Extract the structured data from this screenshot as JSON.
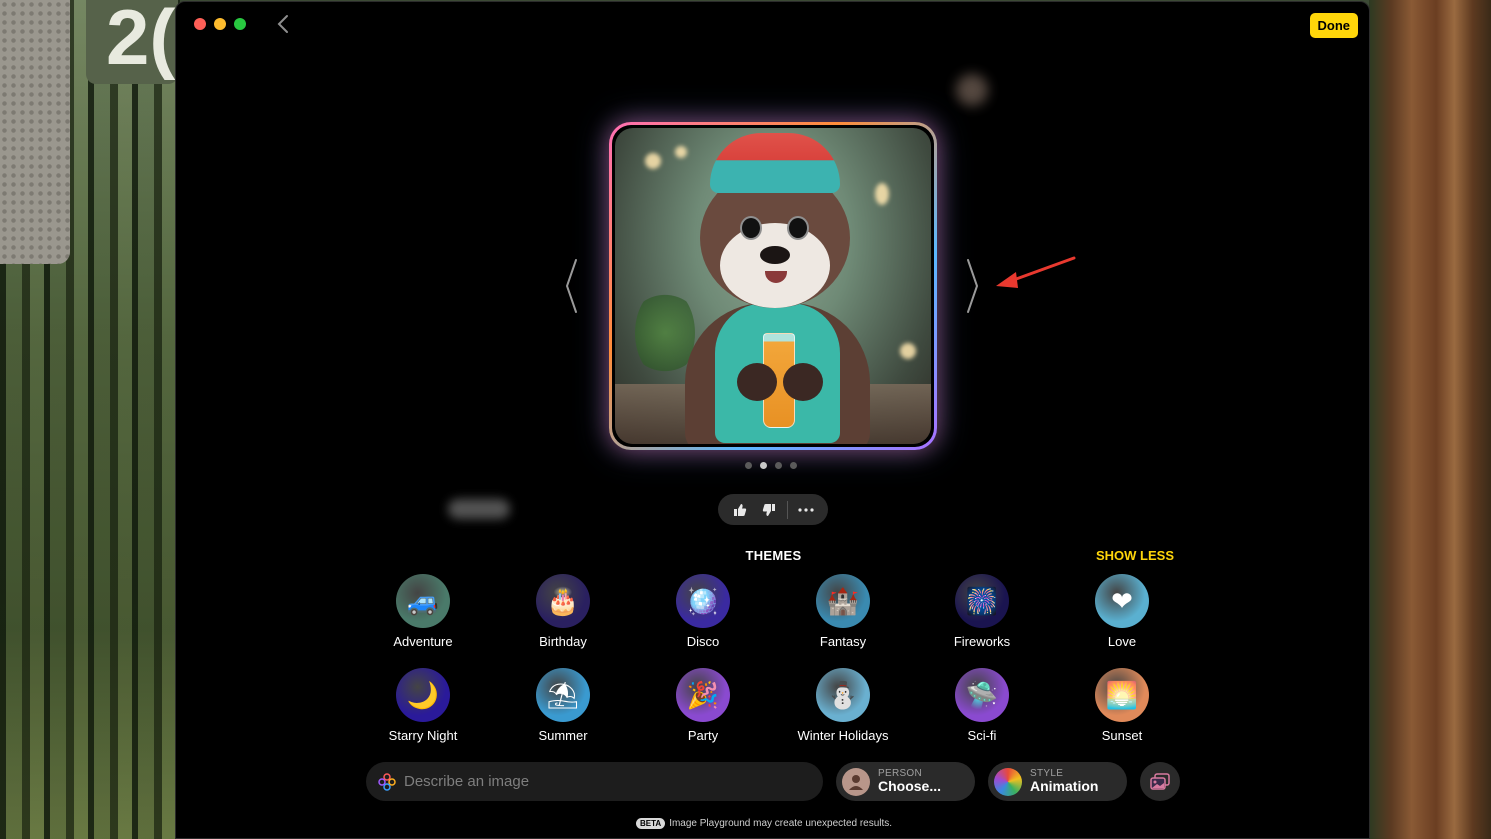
{
  "window": {
    "done_label": "Done",
    "back_icon": "chevron-left-icon"
  },
  "desktop": {
    "widget_text": "2("
  },
  "preview": {
    "subject": "otter holding a drink wearing a beanie",
    "page_count": 4,
    "active_page": 2
  },
  "themes": {
    "title": "THEMES",
    "toggle_label": "SHOW LESS",
    "items": [
      {
        "label": "Adventure",
        "icon": "jeep-icon",
        "color": "#4a7a6a",
        "glyph": "🚙"
      },
      {
        "label": "Birthday",
        "icon": "cake-icon",
        "color": "#2a2060",
        "glyph": "🎂"
      },
      {
        "label": "Disco",
        "icon": "disco-ball-icon",
        "color": "#3a2aa0",
        "glyph": "🪩"
      },
      {
        "label": "Fantasy",
        "icon": "castle-icon",
        "color": "#3a8ab0",
        "glyph": "🏰"
      },
      {
        "label": "Fireworks",
        "icon": "fireworks-icon",
        "color": "#1a1450",
        "glyph": "🎆"
      },
      {
        "label": "Love",
        "icon": "heart-icon",
        "color": "#5ab0d0",
        "glyph": "❤"
      },
      {
        "label": "Starry Night",
        "icon": "moon-stars-icon",
        "color": "#2a1a9a",
        "glyph": "🌙"
      },
      {
        "label": "Summer",
        "icon": "beach-umbrella-icon",
        "color": "#3a9ad0",
        "glyph": "⛱"
      },
      {
        "label": "Party",
        "icon": "party-popper-icon",
        "color": "#8a4ad0",
        "glyph": "🎉"
      },
      {
        "label": "Winter Holidays",
        "icon": "snowman-icon",
        "color": "#6ab0d0",
        "glyph": "⛄"
      },
      {
        "label": "Sci-fi",
        "icon": "ufo-icon",
        "color": "#8a4ad0",
        "glyph": "🛸"
      },
      {
        "label": "Sunset",
        "icon": "sunset-icon",
        "color": "#e08a5a",
        "glyph": "🌅"
      }
    ]
  },
  "prompt": {
    "placeholder": "Describe an image"
  },
  "person": {
    "caption": "PERSON",
    "value": "Choose..."
  },
  "style": {
    "caption": "STYLE",
    "value": "Animation"
  },
  "footer": {
    "badge": "BETA",
    "text": "Image Playground may create unexpected results."
  },
  "colors": {
    "accent": "#ffd60a",
    "annotation_arrow": "#e8392f"
  }
}
